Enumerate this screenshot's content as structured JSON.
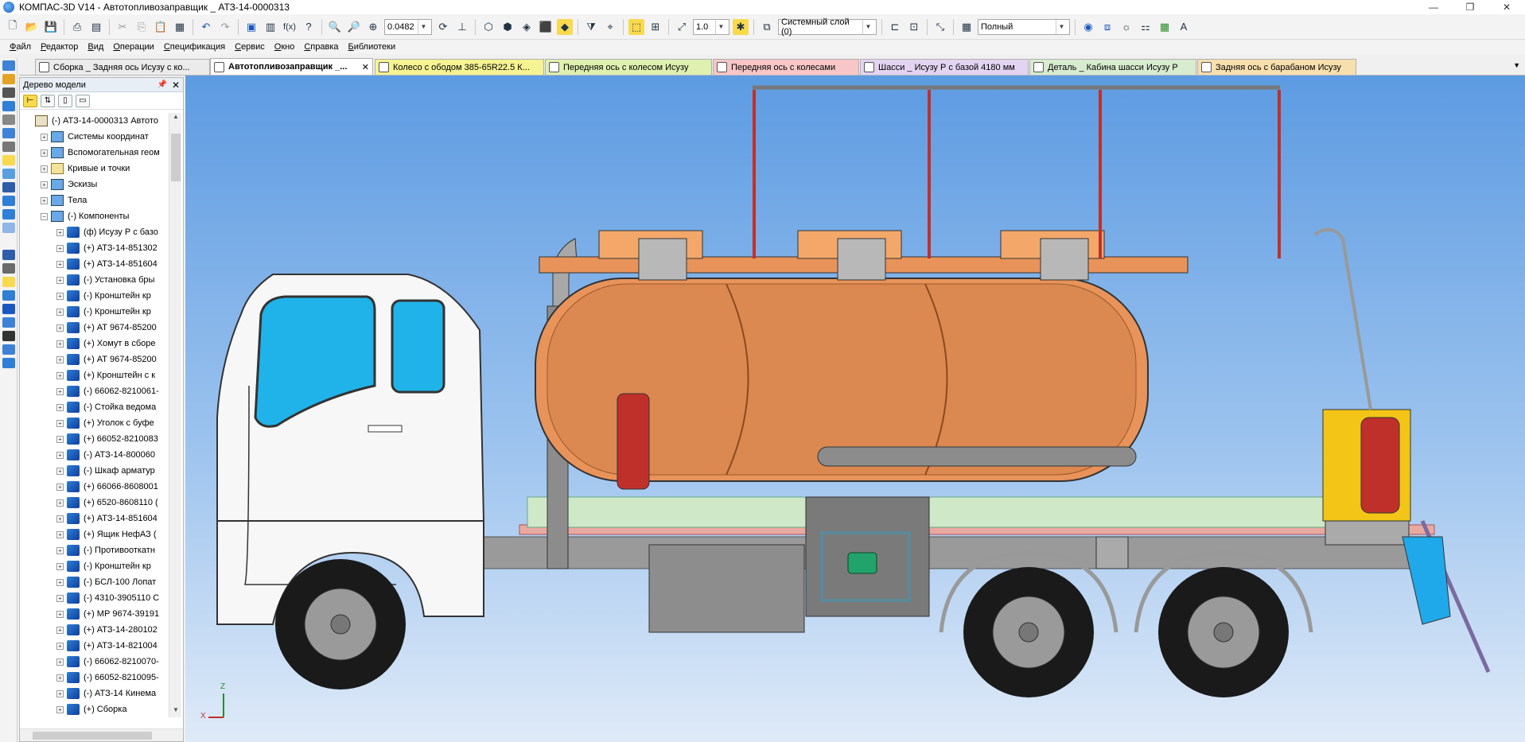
{
  "window": {
    "title": "КОМПАС-3D V14 - Автотопливозаправщик _ АТЗ-14-0000313",
    "controls": [
      "—",
      "❐",
      "✕"
    ]
  },
  "toolbar": {
    "scale_value": "0.0482",
    "step_value": "1.0",
    "layer_value": "Системный слой (0)",
    "display_mode": "Полный"
  },
  "menu": {
    "items": [
      "Файл",
      "Редактор",
      "Вид",
      "Операции",
      "Спецификация",
      "Сервис",
      "Окно",
      "Справка",
      "Библиотеки"
    ]
  },
  "tabs": [
    {
      "label": "Сборка _ Задняя ось Исузу с ко...",
      "color": "#ebebeb",
      "active": false
    },
    {
      "label": "Автотопливозаправщик _...",
      "color": "#ffffff",
      "active": true
    },
    {
      "label": "Колесо с ободом 385-65R22.5 К...",
      "color": "#f6f392",
      "active": false
    },
    {
      "label": "Передняя ось с колесом Исузу",
      "color": "#dff0b0",
      "active": false
    },
    {
      "label": "Передняя ось с колесами",
      "color": "#f8c6c6",
      "active": false
    },
    {
      "label": "Шасси _ Исузу Р с базой 4180 мм",
      "color": "#e3d4f2",
      "active": false
    },
    {
      "label": "Деталь _ Кабина шасси Исузу Р",
      "color": "#d8ecd0",
      "active": false
    },
    {
      "label": "Задняя ось с барабаном Исузу",
      "color": "#f8dfae",
      "active": false
    }
  ],
  "tree_panel": {
    "title": "Дерево модели",
    "items": [
      {
        "label": "(-) АТЗ-14-0000313 Автото",
        "level": 0,
        "expander": "",
        "icon": "root"
      },
      {
        "label": "Системы координат",
        "level": 1,
        "expander": "+",
        "icon": "sys"
      },
      {
        "label": "Вспомогательная геом",
        "level": 1,
        "expander": "+",
        "icon": "sys"
      },
      {
        "label": "Кривые и точки",
        "level": 1,
        "expander": "+",
        "icon": "folder"
      },
      {
        "label": "Эскизы",
        "level": 1,
        "expander": "+",
        "icon": "sys"
      },
      {
        "label": "Тела",
        "level": 1,
        "expander": "+",
        "icon": "sys"
      },
      {
        "label": "(-) Компоненты",
        "level": 1,
        "expander": "−",
        "icon": "sys"
      },
      {
        "label": "(ф) Исузу Р с базо",
        "level": 2,
        "expander": "+",
        "icon": "comp"
      },
      {
        "label": "(+) АТЗ-14-851302",
        "level": 2,
        "expander": "+",
        "icon": "comp"
      },
      {
        "label": "(+) АТЗ-14-851604",
        "level": 2,
        "expander": "+",
        "icon": "comp"
      },
      {
        "label": "(-) Установка бры",
        "level": 2,
        "expander": "+",
        "icon": "comp"
      },
      {
        "label": "(-) Кронштейн кр",
        "level": 2,
        "expander": "+",
        "icon": "comp"
      },
      {
        "label": "(-) Кронштейн кр",
        "level": 2,
        "expander": "+",
        "icon": "comp"
      },
      {
        "label": "(+) АТ 9674-85200",
        "level": 2,
        "expander": "+",
        "icon": "comp"
      },
      {
        "label": "(+) Хомут в сборе",
        "level": 2,
        "expander": "+",
        "icon": "comp"
      },
      {
        "label": "(+) АТ 9674-85200",
        "level": 2,
        "expander": "+",
        "icon": "comp"
      },
      {
        "label": "(+) Кронштейн с к",
        "level": 2,
        "expander": "+",
        "icon": "comp"
      },
      {
        "label": "(-) 66062-8210061-",
        "level": 2,
        "expander": "+",
        "icon": "comp"
      },
      {
        "label": "(-) Стойка ведома",
        "level": 2,
        "expander": "+",
        "icon": "comp"
      },
      {
        "label": "(+) Уголок с буфе",
        "level": 2,
        "expander": "+",
        "icon": "comp"
      },
      {
        "label": "(+) 66052-8210083",
        "level": 2,
        "expander": "+",
        "icon": "comp"
      },
      {
        "label": "(-) АТЗ-14-800060",
        "level": 2,
        "expander": "+",
        "icon": "comp"
      },
      {
        "label": "(-) Шкаф арматур",
        "level": 2,
        "expander": "+",
        "icon": "comp"
      },
      {
        "label": "(+) 66066-8608001",
        "level": 2,
        "expander": "+",
        "icon": "comp"
      },
      {
        "label": "(+) 6520-8608110 (",
        "level": 2,
        "expander": "+",
        "icon": "comp"
      },
      {
        "label": "(+) АТЗ-14-851604",
        "level": 2,
        "expander": "+",
        "icon": "comp"
      },
      {
        "label": "(+) Ящик НефАЗ (",
        "level": 2,
        "expander": "+",
        "icon": "comp"
      },
      {
        "label": "(-) Противооткатн",
        "level": 2,
        "expander": "+",
        "icon": "comp"
      },
      {
        "label": "(-) Кронштейн кр",
        "level": 2,
        "expander": "+",
        "icon": "comp"
      },
      {
        "label": "(-) БСЛ-100 Лопат",
        "level": 2,
        "expander": "+",
        "icon": "comp"
      },
      {
        "label": "(-) 4310-3905110 С",
        "level": 2,
        "expander": "+",
        "icon": "comp"
      },
      {
        "label": "(+) МР 9674-39191",
        "level": 2,
        "expander": "+",
        "icon": "comp"
      },
      {
        "label": "(+) АТЗ-14-280102",
        "level": 2,
        "expander": "+",
        "icon": "comp"
      },
      {
        "label": "(+) АТЗ-14-821004",
        "level": 2,
        "expander": "+",
        "icon": "comp"
      },
      {
        "label": "(-) 66062-8210070-",
        "level": 2,
        "expander": "+",
        "icon": "comp"
      },
      {
        "label": "(-) 66052-8210095-",
        "level": 2,
        "expander": "+",
        "icon": "comp"
      },
      {
        "label": "(-) АТЗ-14 Кинема",
        "level": 2,
        "expander": "+",
        "icon": "comp"
      },
      {
        "label": "(+) Сборка",
        "level": 2,
        "expander": "+",
        "icon": "comp"
      }
    ]
  },
  "viewport": {
    "axis_labels": {
      "z": "Z",
      "x": "X"
    }
  }
}
